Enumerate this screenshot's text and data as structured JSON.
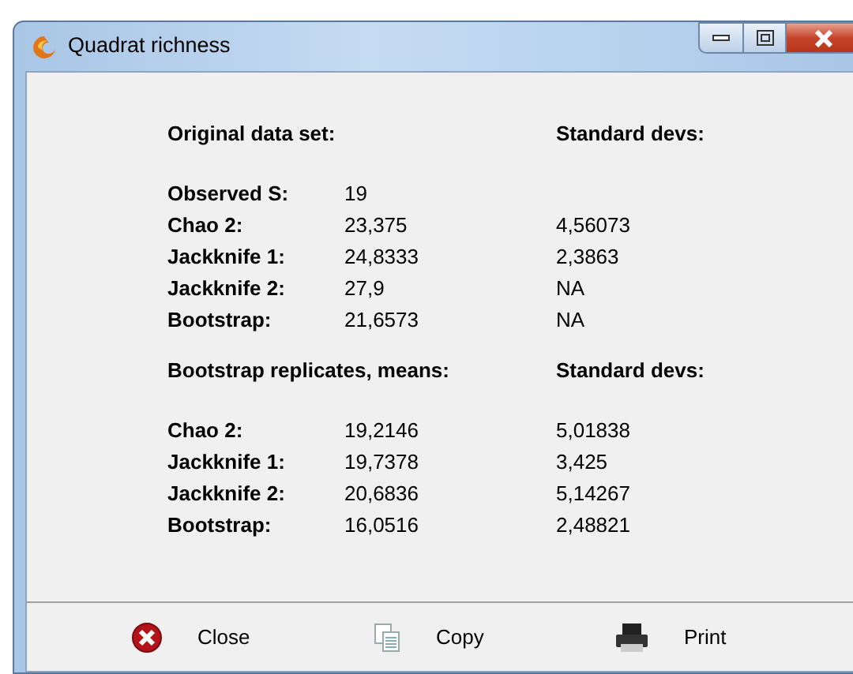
{
  "window": {
    "title": "Quadrat richness"
  },
  "sections": [
    {
      "heading": "Original data set:",
      "sd_heading": "Standard devs:",
      "rows": [
        {
          "label": "Observed S:",
          "value": "19"
        },
        {
          "label": "Chao 2:",
          "value": "23,375",
          "sd": "4,56073"
        },
        {
          "label": "Jackknife 1:",
          "value": "24,8333",
          "sd": "2,3863"
        },
        {
          "label": "Jackknife 2:",
          "value": "27,9",
          "sd": "NA"
        },
        {
          "label": "Bootstrap:",
          "value": "21,6573",
          "sd": "NA"
        }
      ]
    },
    {
      "heading": "Bootstrap replicates, means:",
      "sd_heading": "Standard devs:",
      "rows": [
        {
          "label": "Chao 2:",
          "value": "19,2146",
          "sd": "5,01838"
        },
        {
          "label": "Jackknife 1:",
          "value": "19,7378",
          "sd": "3,425"
        },
        {
          "label": "Jackknife 2:",
          "value": "20,6836",
          "sd": "5,14267"
        },
        {
          "label": "Bootstrap:",
          "value": "16,0516",
          "sd": "2,48821"
        }
      ]
    }
  ],
  "buttons": [
    {
      "label": "Close",
      "kind": "close"
    },
    {
      "label": "Copy",
      "kind": "copy"
    },
    {
      "label": "Print",
      "kind": "print"
    }
  ]
}
